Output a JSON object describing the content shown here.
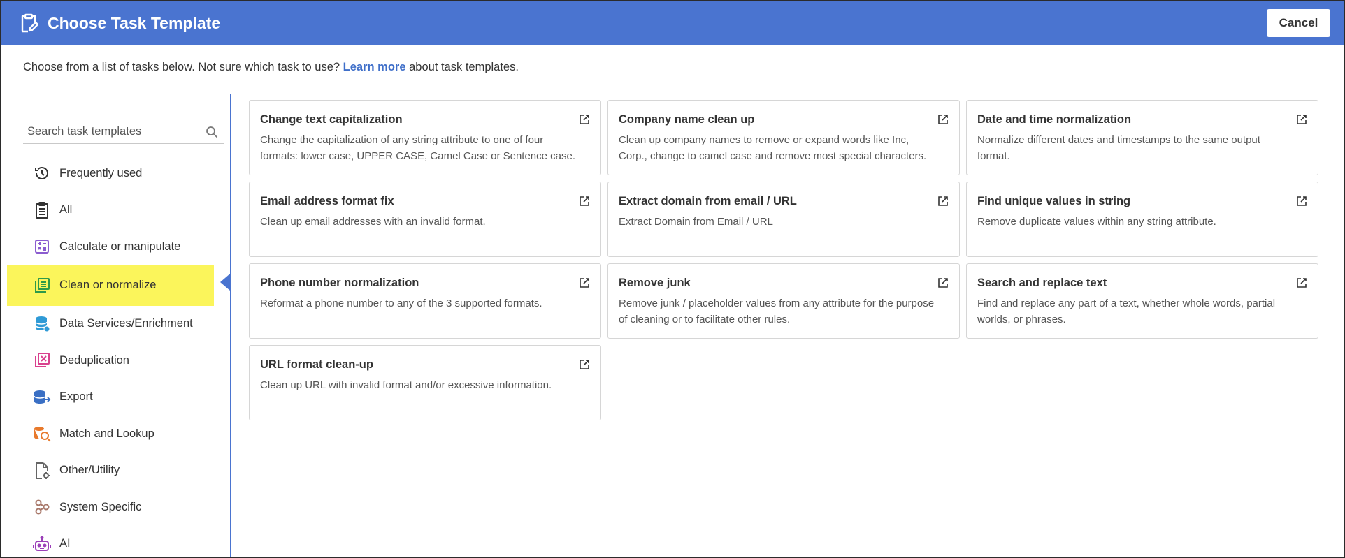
{
  "header": {
    "title": "Choose Task Template",
    "cancel_label": "Cancel"
  },
  "intro": {
    "text_before": "Choose from a list of tasks below. Not sure which task to use?",
    "link": "Learn more",
    "text_after": "about task templates."
  },
  "search": {
    "placeholder": "Search task templates",
    "value": ""
  },
  "sidebar": {
    "items": [
      {
        "label": "Frequently used",
        "icon": "history-icon",
        "active": false
      },
      {
        "label": "All",
        "icon": "clipboard-list-icon",
        "active": false
      },
      {
        "label": "Calculate or manipulate",
        "icon": "calculator-icon",
        "active": false
      },
      {
        "label": "Clean or normalize",
        "icon": "table-clean-icon",
        "active": true
      },
      {
        "label": "Data Services/Enrichment",
        "icon": "database-icon",
        "active": false
      },
      {
        "label": "Deduplication",
        "icon": "deduplicate-icon",
        "active": false
      },
      {
        "label": "Export",
        "icon": "export-database-icon",
        "active": false
      },
      {
        "label": "Match and Lookup",
        "icon": "match-lookup-icon",
        "active": false
      },
      {
        "label": "Other/Utility",
        "icon": "file-gear-icon",
        "active": false
      },
      {
        "label": "System Specific",
        "icon": "system-nodes-icon",
        "active": false
      },
      {
        "label": "AI",
        "icon": "robot-icon",
        "active": false
      }
    ]
  },
  "cards": [
    {
      "title": "Change text capitalization",
      "desc": "Change the capitalization of any string attribute to one of four formats: lower case, UPPER CASE, Camel Case or Sentence case."
    },
    {
      "title": "Company name clean up",
      "desc": "Clean up company names to remove or expand words like Inc, Corp., change to camel case and remove most special characters."
    },
    {
      "title": "Date and time normalization",
      "desc": "Normalize different dates and timestamps to the same output format."
    },
    {
      "title": "Email address format fix",
      "desc": "Clean up email addresses with an invalid format."
    },
    {
      "title": "Extract domain from email / URL",
      "desc": "Extract Domain from Email / URL"
    },
    {
      "title": "Find unique values in string",
      "desc": "Remove duplicate values within any string attribute."
    },
    {
      "title": "Phone number normalization",
      "desc": "Reformat a phone number to any of the 3 supported formats."
    },
    {
      "title": "Remove junk",
      "desc": "Remove junk / placeholder values from any attribute for the purpose of cleaning or to facilitate other rules."
    },
    {
      "title": "Search and replace text",
      "desc": "Find and replace any part of a text, whether whole words, partial worlds, or phrases."
    },
    {
      "title": "URL format clean-up",
      "desc": "Clean up URL with invalid format and/or excessive information."
    }
  ],
  "colors": {
    "header_bg": "#4a74d0",
    "active_highlight": "#fbf55b",
    "link": "#3f6fc9"
  }
}
